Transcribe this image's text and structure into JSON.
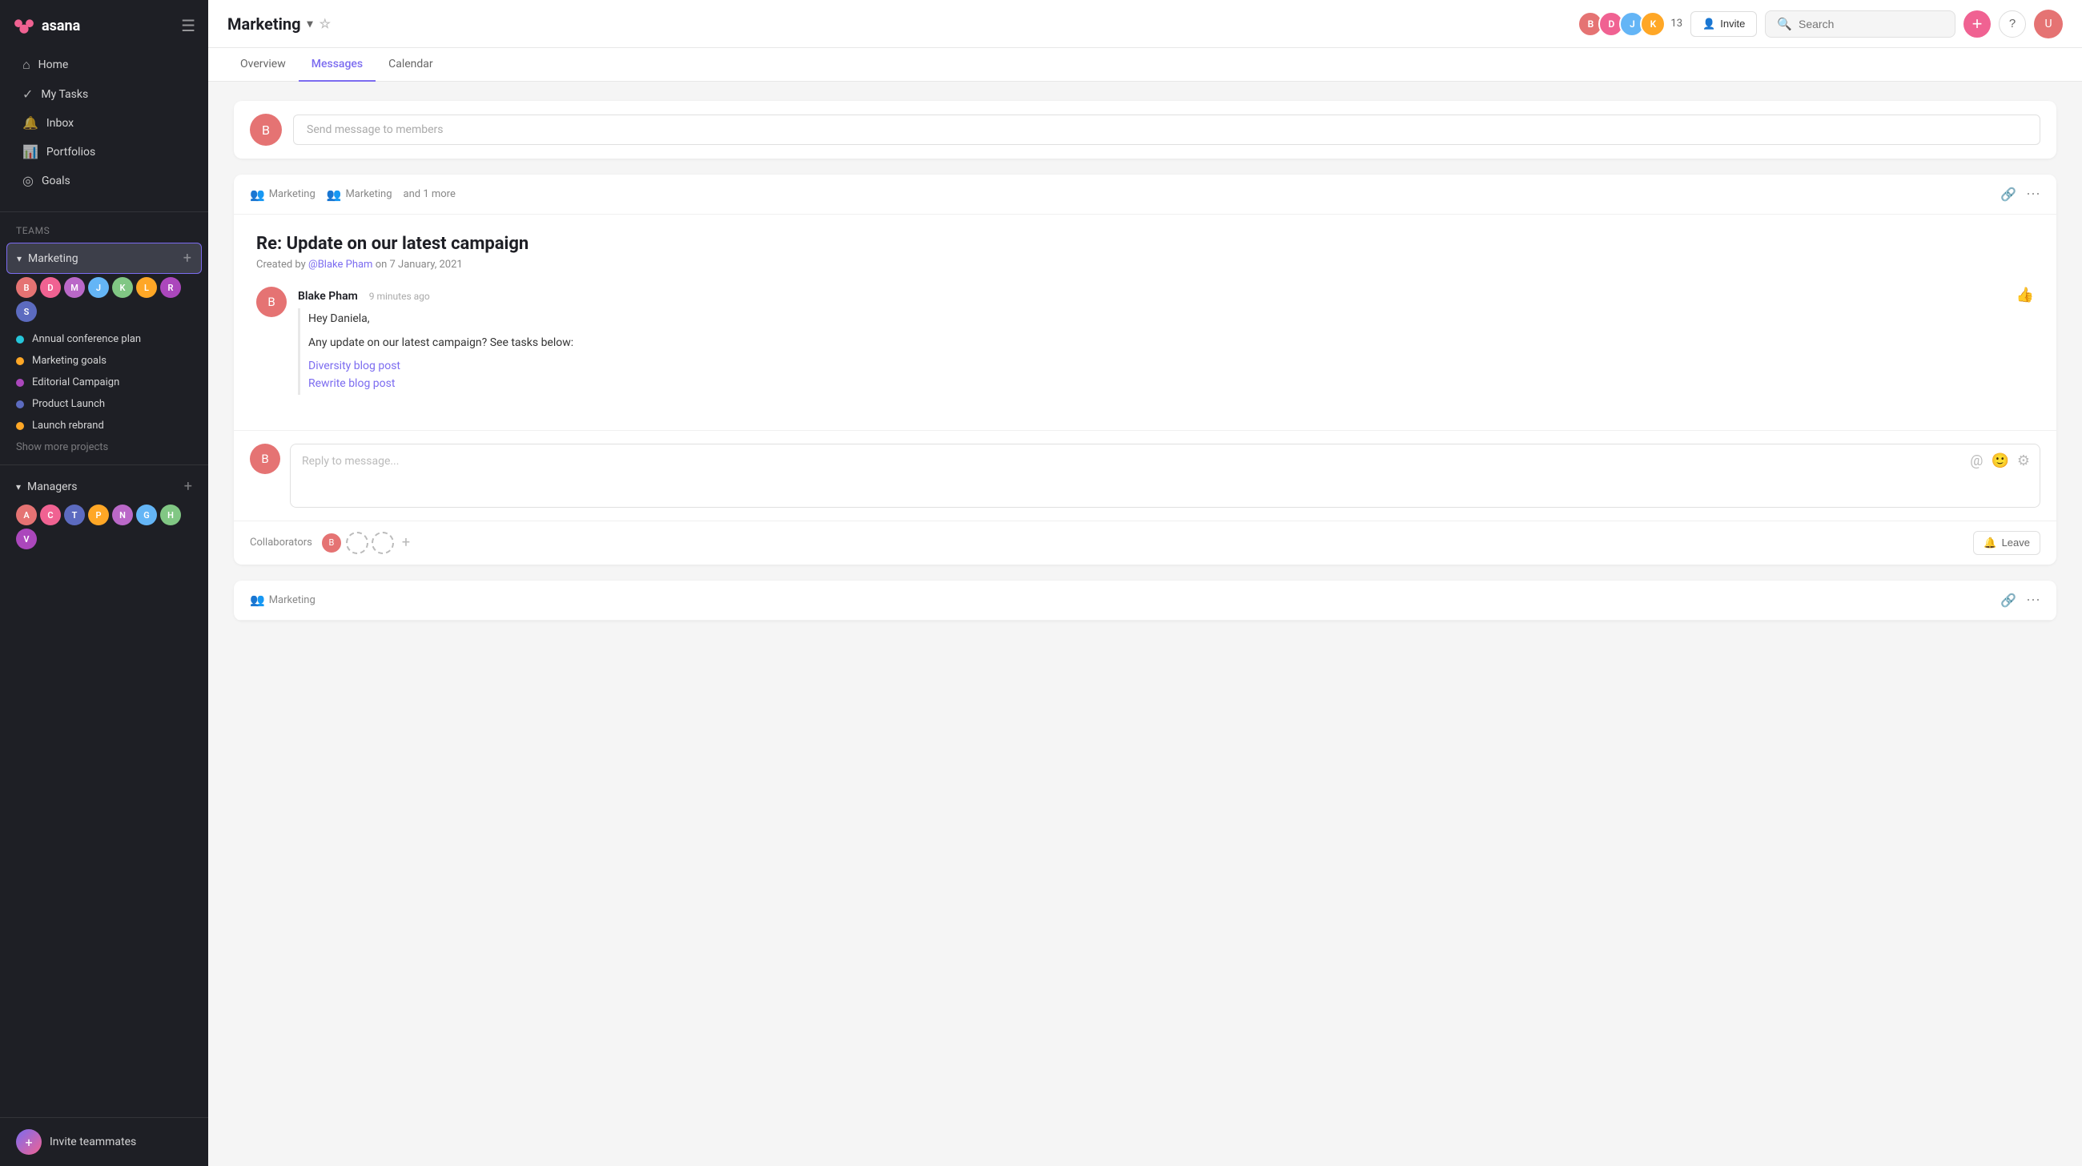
{
  "app": {
    "name": "asana",
    "logo_text": "asana"
  },
  "sidebar": {
    "toggle_label": "Toggle sidebar",
    "nav_items": [
      {
        "id": "home",
        "label": "Home",
        "icon": "⌂"
      },
      {
        "id": "my-tasks",
        "label": "My Tasks",
        "icon": "✓"
      },
      {
        "id": "inbox",
        "label": "Inbox",
        "icon": "🔔"
      },
      {
        "id": "portfolios",
        "label": "Portfolios",
        "icon": "📊"
      },
      {
        "id": "goals",
        "label": "Goals",
        "icon": "◎"
      }
    ],
    "teams_label": "Teams",
    "team_marketing": {
      "name": "Marketing",
      "active": true,
      "add_label": "+"
    },
    "team_managers": {
      "name": "Managers",
      "add_label": "+"
    },
    "projects": [
      {
        "id": "annual-conference",
        "label": "Annual conference plan",
        "color": "#26c6da"
      },
      {
        "id": "marketing-goals",
        "label": "Marketing goals",
        "color": "#ffa726"
      },
      {
        "id": "editorial-campaign",
        "label": "Editorial Campaign",
        "color": "#ab47bc"
      },
      {
        "id": "product-launch",
        "label": "Product Launch",
        "color": "#5c6bc0"
      },
      {
        "id": "launch-rebrand",
        "label": "Launch rebrand",
        "color": "#ffa726"
      }
    ],
    "show_more_label": "Show more projects",
    "invite_teammates_label": "Invite teammates"
  },
  "topbar": {
    "project_name": "Marketing",
    "chevron_icon": "▾",
    "star_icon": "☆",
    "member_count": "13",
    "invite_label": "Invite",
    "search_placeholder": "Search",
    "add_icon": "+",
    "help_icon": "?"
  },
  "tabs": [
    {
      "id": "overview",
      "label": "Overview",
      "active": false
    },
    {
      "id": "messages",
      "label": "Messages",
      "active": true
    },
    {
      "id": "calendar",
      "label": "Calendar",
      "active": false
    }
  ],
  "compose": {
    "placeholder": "Send message to members"
  },
  "thread": {
    "recipients": [
      {
        "icon": "👥",
        "label": "Marketing"
      },
      {
        "icon": "👥",
        "label": "Marketing"
      }
    ],
    "and_more": "and 1 more",
    "title": "Re: Update on our latest campaign",
    "created_by_prefix": "Created by",
    "author_mention": "@Blake Pham",
    "created_date": "on 7 January, 2021",
    "message": {
      "author": "Blake Pham",
      "time": "9 minutes ago",
      "greeting": "Hey Daniela,",
      "body": "Any update on our latest campaign? See tasks below:",
      "links": [
        {
          "label": "Diversity blog post",
          "href": "#"
        },
        {
          "label": "Rewrite blog post",
          "href": "#"
        }
      ]
    },
    "reply_placeholder": "Reply to message...",
    "collaborators_label": "Collaborators",
    "leave_label": "Leave",
    "bell_icon": "🔔"
  },
  "thread2": {
    "recipient": "Marketing",
    "recipient_icon": "👥"
  },
  "avatars": {
    "colors": [
      "#e57373",
      "#64b5f6",
      "#81c784",
      "#ffb74d",
      "#ba68c8",
      "#4dd0e1",
      "#f06292",
      "#a1887f"
    ]
  }
}
